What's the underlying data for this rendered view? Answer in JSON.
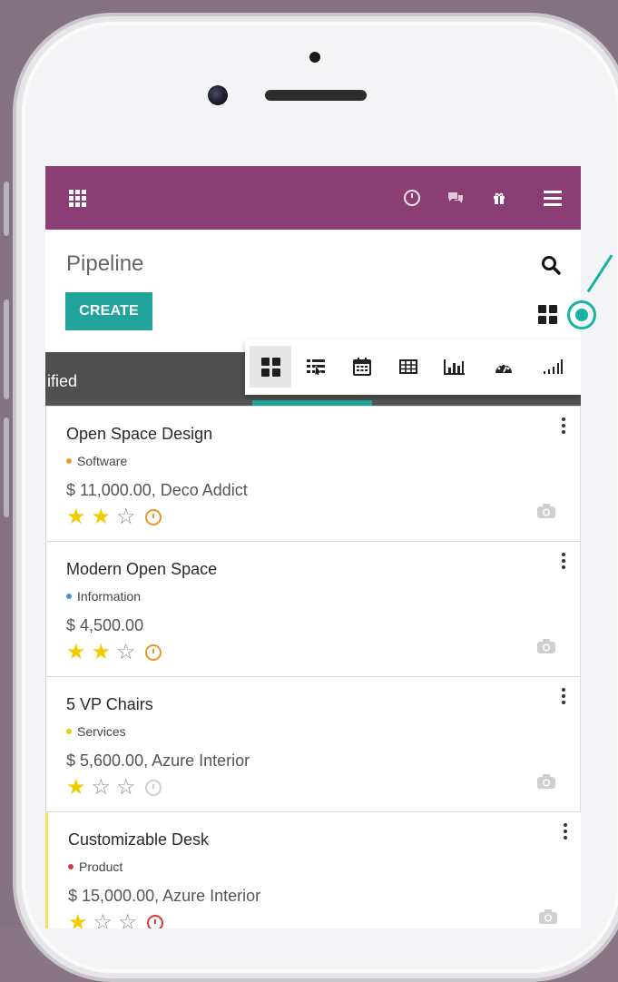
{
  "navbar": {
    "accent_color": "#8a3e73",
    "icons": [
      "apps-icon",
      "clock-icon",
      "chat-icon",
      "gift-icon",
      "hamburger-menu-icon"
    ]
  },
  "control_panel": {
    "title": "Pipeline",
    "create_label": "CREATE"
  },
  "stage": {
    "label": "ified"
  },
  "view_switcher": {
    "views": [
      "kanban-icon",
      "list-icon",
      "calendar-icon",
      "pivot-icon",
      "graph-icon",
      "dashboard-icon",
      "cohort-icon"
    ],
    "active": "kanban-icon"
  },
  "cards": [
    {
      "title": "Open Space Design",
      "tag": "Software",
      "tag_color": "#e59a28",
      "amount": "$ 11,000.00, Deco Addict",
      "stars": 2,
      "activity": "orange"
    },
    {
      "title": "Modern Open Space",
      "tag": "Information",
      "tag_color": "#4a90e2",
      "amount": "$ 4,500.00",
      "stars": 2,
      "activity": "orange"
    },
    {
      "title": "5 VP Chairs",
      "tag": "Services",
      "tag_color": "#e3d400",
      "amount": "$ 5,600.00, Azure Interior",
      "stars": 1,
      "activity": "grey"
    },
    {
      "title": "Customizable Desk",
      "tag": "Product",
      "tag_color": "#d9363e",
      "amount": "$ 15,000.00, Azure Interior",
      "stars": 1,
      "activity": "red"
    }
  ]
}
